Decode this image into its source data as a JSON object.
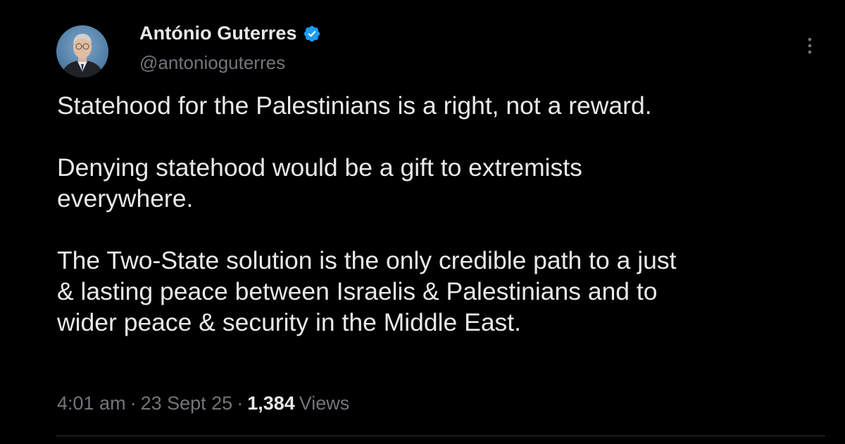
{
  "author": {
    "display_name": "António Guterres",
    "handle": "@antonioguterres",
    "verified_icon": "verified-badge-icon",
    "verified_color": "#1d9bf0"
  },
  "menu": {
    "more_icon": "more-vertical-icon"
  },
  "tweet": {
    "paragraphs": [
      "Statehood for the Palestinians is a right, not a reward.",
      "Denying statehood would be a gift to extremists\neverywhere.",
      "The Two-State solution is the only credible path to a just\n& lasting peace between Israelis & Palestinians and to\nwider peace & security in the Middle East."
    ]
  },
  "meta": {
    "time": "4:01 am",
    "separator": "·",
    "date": "23 Sept 25",
    "views_count": "1,384",
    "views_label": "Views"
  },
  "colors": {
    "background": "#000000",
    "text_primary": "#e7e9ea",
    "text_secondary": "#71767b",
    "divider": "#2f3336"
  }
}
